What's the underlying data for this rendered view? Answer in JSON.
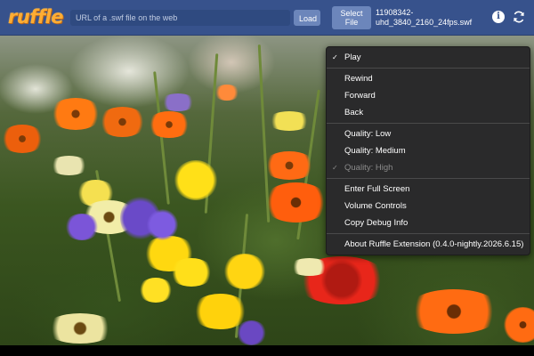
{
  "toolbar": {
    "logo": "ruffle",
    "url_placeholder": "URL of a .swf file on the web",
    "url_value": "",
    "load_label": "Load",
    "select_file_label": "Select\nFile",
    "file_name": "11908342-\nuhd_3840_2160_24fps.swf",
    "icons": {
      "info": "info-icon",
      "reload": "reload-icon"
    }
  },
  "colors": {
    "toolbar_bg": "#37528c",
    "logo_orange": "#ffad33",
    "button_bg": "#6c86bb",
    "menu_bg": "#2a2a2b"
  },
  "context_menu": {
    "groups": [
      [
        {
          "label": "Play",
          "checked": true,
          "enabled": true
        }
      ],
      [
        {
          "label": "Rewind",
          "checked": false,
          "enabled": true
        },
        {
          "label": "Forward",
          "checked": false,
          "enabled": true
        },
        {
          "label": "Back",
          "checked": false,
          "enabled": true
        }
      ],
      [
        {
          "label": "Quality: Low",
          "checked": false,
          "enabled": true
        },
        {
          "label": "Quality: Medium",
          "checked": false,
          "enabled": true
        },
        {
          "label": "Quality: High",
          "checked": true,
          "enabled": false
        }
      ],
      [
        {
          "label": "Enter Full Screen",
          "checked": false,
          "enabled": true
        },
        {
          "label": "Volume Controls",
          "checked": false,
          "enabled": true
        },
        {
          "label": "Copy Debug Info",
          "checked": false,
          "enabled": true
        }
      ],
      [
        {
          "label": "About Ruffle Extension (0.4.0-nightly.2026.6.15)",
          "checked": false,
          "enabled": true
        }
      ]
    ]
  }
}
